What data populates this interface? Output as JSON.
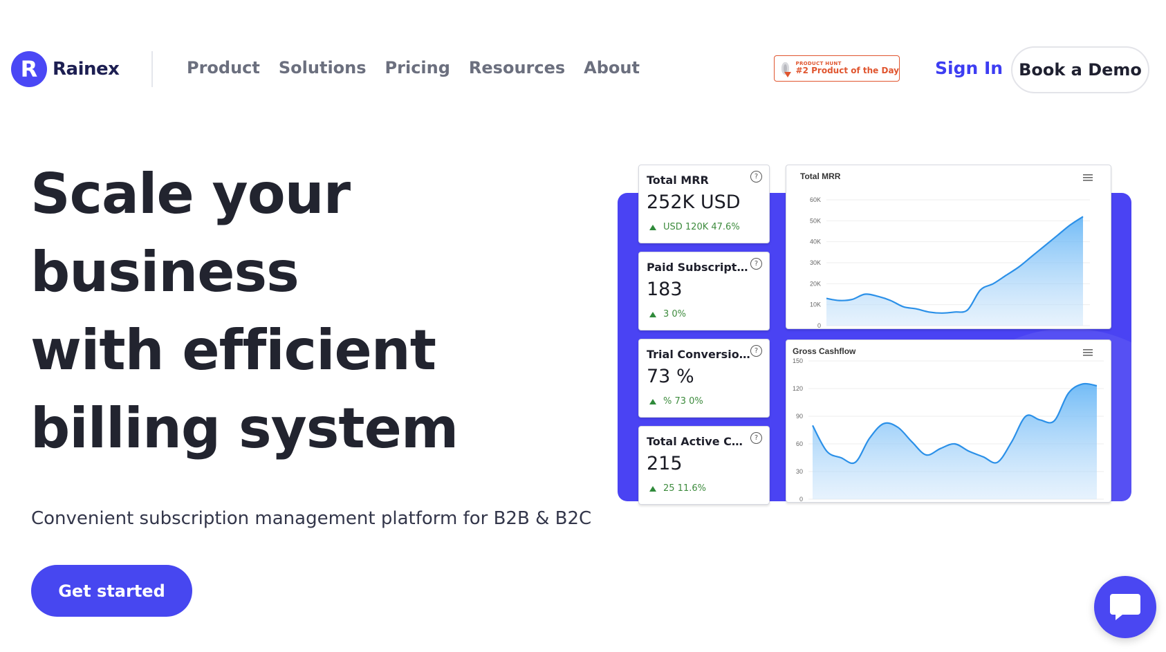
{
  "brand": {
    "logo_letter": "R",
    "name": "Rainex",
    "accent": "#4a47f5"
  },
  "nav": {
    "items": [
      "Product",
      "Solutions",
      "Pricing",
      "Resources",
      "About"
    ]
  },
  "product_hunt": {
    "small": "PRODUCT HUNT",
    "main": "#2 Product of the Day",
    "color": "#e0552f"
  },
  "header": {
    "sign_in": "Sign In",
    "book_demo": "Book a Demo"
  },
  "hero": {
    "title_lines": [
      "Scale your",
      "business",
      "with efficient",
      "billing system"
    ],
    "subtitle": "Convenient subscription management platform for B2B & B2C",
    "cta": "Get started"
  },
  "dashboard": {
    "kpis": [
      {
        "title": "Total MRR",
        "value": "252K USD",
        "change": "USD 120K 47.6%"
      },
      {
        "title": "Paid Subscriptio...",
        "value": "183",
        "change": "3 0%"
      },
      {
        "title": "Trial Conversion ...",
        "value": "73 %",
        "change": "% 73 0%"
      },
      {
        "title": "Total Active Cust...",
        "value": "215",
        "change": "25 11.6%"
      }
    ],
    "help_glyph": "?"
  },
  "chart_data": [
    {
      "type": "area",
      "title": "Total MRR",
      "y_ticks": [
        "60K",
        "50K",
        "40K",
        "30K",
        "20K",
        "10K",
        "0"
      ],
      "ylim": [
        0,
        60000
      ],
      "x": [
        0,
        1,
        2,
        3,
        4,
        5,
        6,
        7,
        8,
        9,
        10,
        11,
        12,
        13,
        14,
        15,
        16,
        17,
        18,
        19,
        20
      ],
      "values": [
        13000,
        12000,
        12500,
        15000,
        14000,
        12000,
        9000,
        8000,
        6500,
        6000,
        6500,
        7500,
        17000,
        20000,
        24000,
        28000,
        33000,
        38000,
        43000,
        48000,
        52000
      ],
      "grid": true,
      "color": "#2b90e8"
    },
    {
      "type": "area",
      "title": "Gross Cashflow",
      "y_ticks": [
        "150",
        "120",
        "90",
        "60",
        "30",
        "0"
      ],
      "ylim": [
        0,
        150
      ],
      "x": [
        0,
        1,
        2,
        3,
        4,
        5,
        6,
        7,
        8,
        9,
        10,
        11,
        12,
        13,
        14,
        15,
        16,
        17,
        18,
        19,
        20
      ],
      "values": [
        80,
        52,
        45,
        40,
        66,
        82,
        78,
        62,
        48,
        55,
        60,
        52,
        46,
        40,
        62,
        90,
        86,
        85,
        115,
        125,
        123
      ],
      "grid": true,
      "color": "#2b90e8"
    }
  ],
  "chat": {
    "icon": "chat-bubble-icon"
  }
}
